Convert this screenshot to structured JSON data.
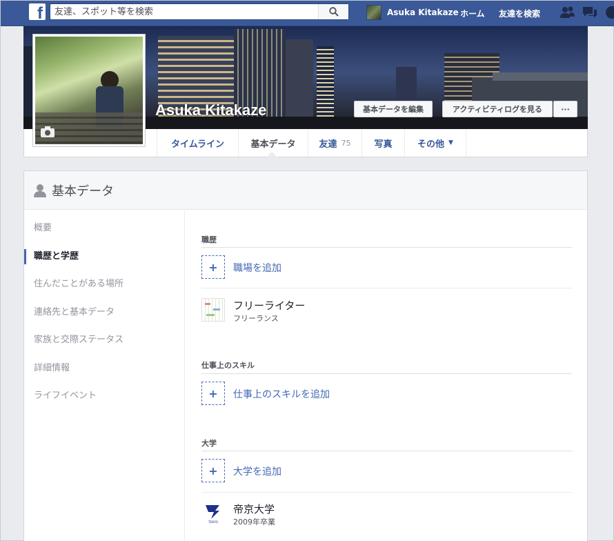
{
  "topbar": {
    "logo": "f",
    "search_placeholder": "友達、スポット等を検索",
    "user_name": "Asuka Kitakaze",
    "home": "ホーム",
    "find_friends": "友達を検索"
  },
  "profile": {
    "name": "Asuka Kitakaze",
    "edit_button": "基本データを編集",
    "activity_button": "アクティビティログを見る",
    "more_button": "···"
  },
  "tabs": {
    "timeline": "タイムライン",
    "about": "基本データ",
    "friends": "友達",
    "friends_count": "75",
    "photos": "写真",
    "more": "その他"
  },
  "about": {
    "title": "基本データ",
    "sidebar": [
      "概要",
      "職歴と学歴",
      "住んだことがある場所",
      "連絡先と基本データ",
      "家族と交際ステータス",
      "詳細情報",
      "ライフイベント"
    ],
    "work_title": "職歴",
    "add_work": "職場を追加",
    "job_title": "フリーライター",
    "job_sub": "フリーランス",
    "skills_title": "仕事上のスキル",
    "add_skill": "仕事上のスキルを追加",
    "college_title": "大学",
    "add_college": "大学を追加",
    "college_name": "帝京大学",
    "college_sub": "2009年卒業",
    "college_logo_text": "TEIKYO"
  },
  "colors": {
    "brand": "#3b5998",
    "link": "#4267b2",
    "background": "#e9ebee"
  }
}
